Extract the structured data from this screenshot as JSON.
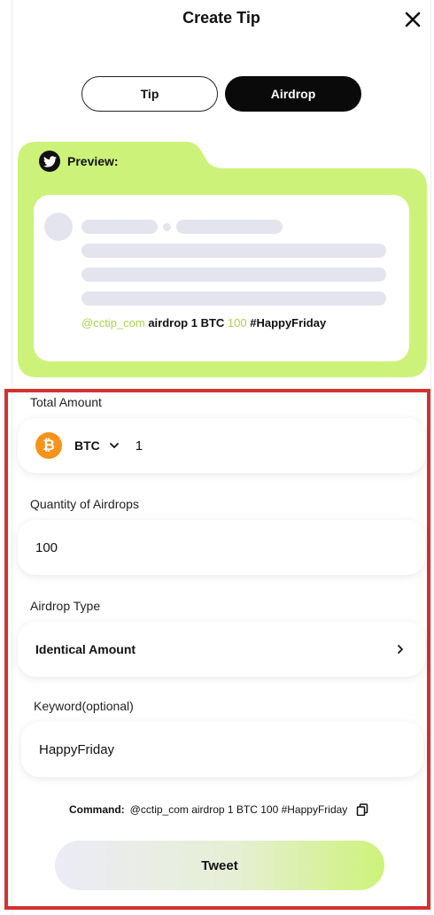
{
  "header": {
    "title": "Create Tip",
    "close_icon": "close-icon"
  },
  "tabs": [
    {
      "label": "Tip",
      "selected": false
    },
    {
      "label": "Airdrop",
      "selected": true
    }
  ],
  "preview": {
    "label": "Preview:",
    "icon": "twitter-icon",
    "tweet": {
      "handle": "@cctip_com",
      "text1": " airdrop 1 BTC ",
      "quantity": "100",
      "hashtag": " #HappyFriday"
    }
  },
  "form": {
    "total_amount": {
      "label": "Total Amount",
      "currency": "BTC",
      "currency_icon": "bitcoin-icon",
      "value": "1"
    },
    "quantity": {
      "label": "Quantity of Airdrops",
      "value": "100"
    },
    "airdrop_type": {
      "label": "Airdrop Type",
      "value": "Identical Amount"
    },
    "keyword": {
      "label": "Keyword(optional)",
      "value": "HappyFriday"
    },
    "command": {
      "label": "Command:",
      "value": "@cctip_com airdrop 1 BTC 100 #HappyFriday",
      "icon": "copy-icon"
    },
    "submit_label": "Tweet"
  },
  "colors": {
    "accent": "#cdf27a",
    "highlight": "#a9d34a",
    "bitcoin": "#f7931a",
    "frame": "#d33131"
  }
}
